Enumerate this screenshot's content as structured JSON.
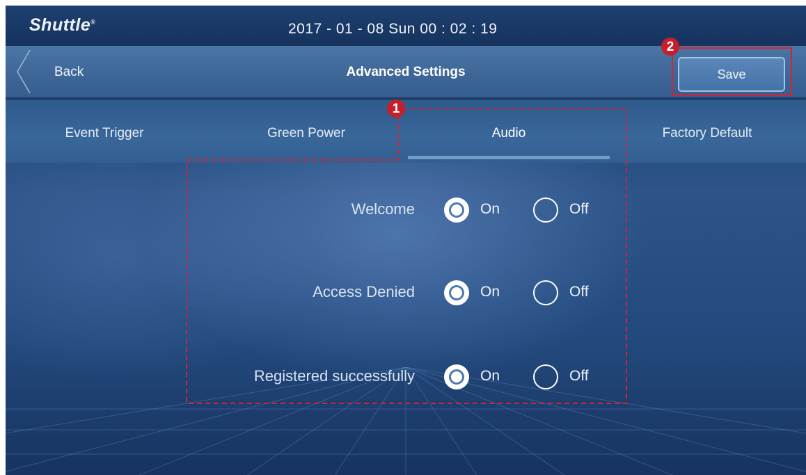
{
  "status_bar": {
    "brand": "Shuttle",
    "brand_mark": "®",
    "datetime": "2017 - 01 - 08  Sun  00 : 02 : 19"
  },
  "title_bar": {
    "back_label": "Back",
    "title": "Advanced Settings",
    "save_label": "Save"
  },
  "tabs": [
    {
      "label": "Event Trigger",
      "active": false
    },
    {
      "label": "Green Power",
      "active": false
    },
    {
      "label": "Audio",
      "active": true
    },
    {
      "label": "Factory Default",
      "active": false
    }
  ],
  "settings": [
    {
      "label": "Welcome",
      "on_label": "On",
      "off_label": "Off",
      "selected": "On"
    },
    {
      "label": "Access Denied",
      "on_label": "On",
      "off_label": "Off",
      "selected": "On"
    },
    {
      "label": "Registered successfully",
      "on_label": "On",
      "off_label": "Off",
      "selected": "On"
    }
  ],
  "annotations": {
    "marker_1": "1",
    "marker_2": "2",
    "color": "#d7232f"
  }
}
